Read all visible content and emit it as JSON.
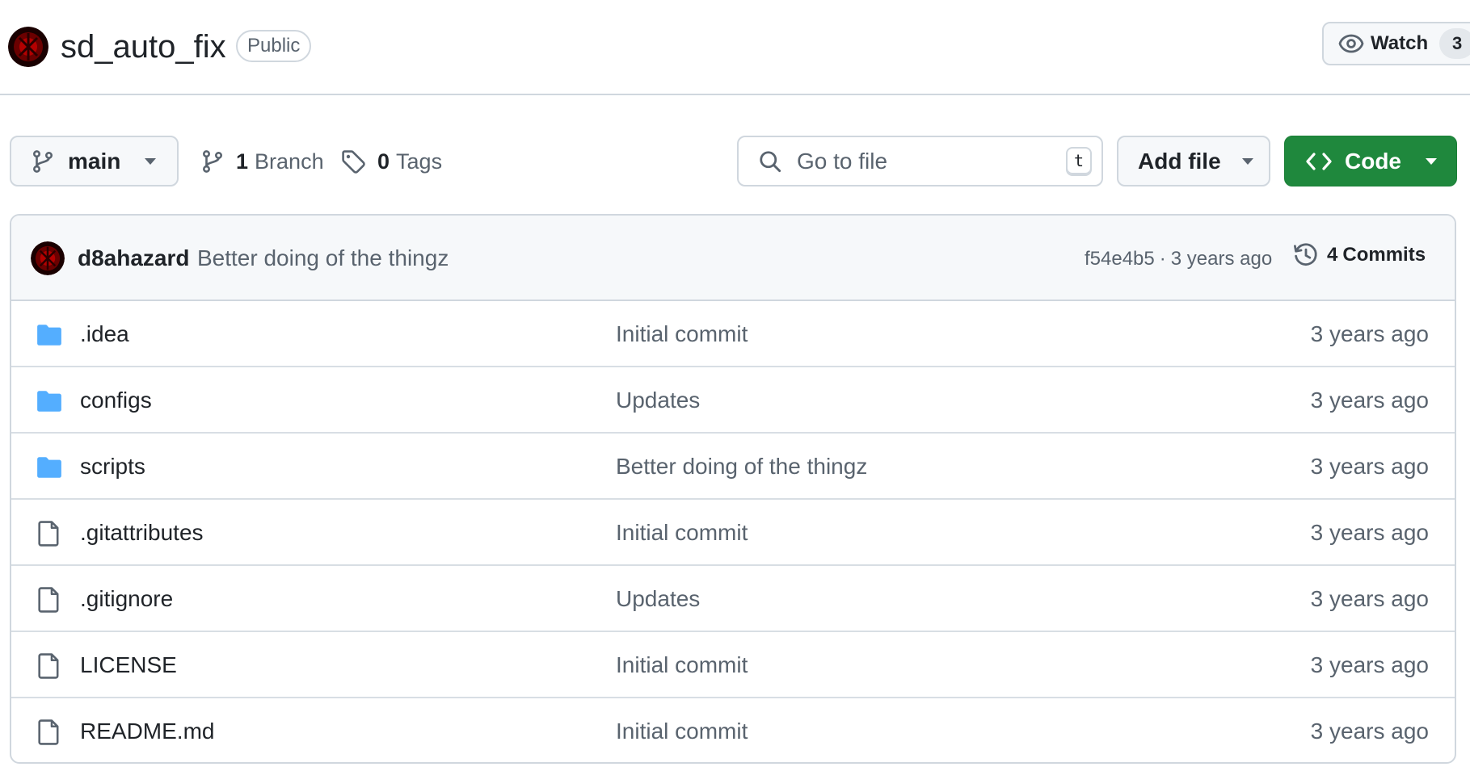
{
  "repo": {
    "name": "sd_auto_fix",
    "visibility": "Public",
    "owner_avatar_icon": "owner-avatar-icon"
  },
  "watch": {
    "label": "Watch",
    "count": "3",
    "icon": "eye-icon"
  },
  "toolbar": {
    "branch_label": "main",
    "branch_count": "1",
    "branch_word": "Branch",
    "tag_count": "0",
    "tag_word": "Tags",
    "search_placeholder": "Go to file",
    "search_shortcut": "t",
    "add_file_label": "Add file",
    "code_label": "Code"
  },
  "latest_commit": {
    "author": "d8ahazard",
    "message": "Better doing of the thingz",
    "sha": "f54e4b5",
    "separator": "·",
    "time": "3 years ago",
    "commits_count": "4",
    "commits_word": "Commits"
  },
  "files": [
    {
      "name": ".idea",
      "type": "folder",
      "message": "Initial commit",
      "date": "3 years ago"
    },
    {
      "name": "configs",
      "type": "folder",
      "message": "Updates",
      "date": "3 years ago"
    },
    {
      "name": "scripts",
      "type": "folder",
      "message": "Better doing of the thingz",
      "date": "3 years ago"
    },
    {
      "name": ".gitattributes",
      "type": "file",
      "message": "Initial commit",
      "date": "3 years ago"
    },
    {
      "name": ".gitignore",
      "type": "file",
      "message": "Updates",
      "date": "3 years ago"
    },
    {
      "name": "LICENSE",
      "type": "file",
      "message": "Initial commit",
      "date": "3 years ago"
    },
    {
      "name": "README.md",
      "type": "file",
      "message": "Initial commit",
      "date": "3 years ago"
    }
  ],
  "colors": {
    "accent_green": "#1f883d",
    "folder_blue": "#54aeff",
    "muted_text": "#59636e",
    "border": "#d0d7de"
  }
}
